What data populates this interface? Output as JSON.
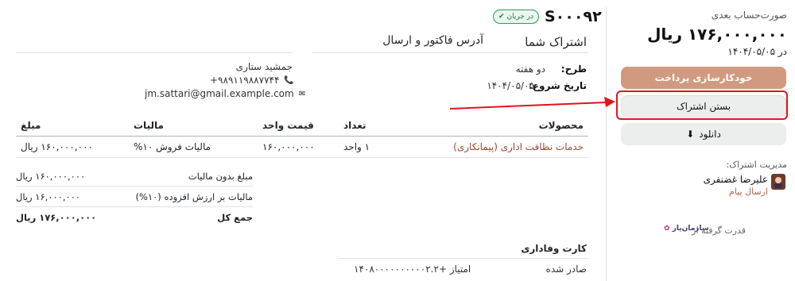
{
  "sidebar": {
    "label": "صورت‌حساب بعدی",
    "amount": "۱۷۶,۰۰۰,۰۰۰ ریال",
    "due": "در ۱۴۰۴/۰۵/۰۵",
    "autopay_button": "خودکارسازی پرداخت",
    "close_button": "بستن اشتراک",
    "download_button": "دانلود",
    "manage_label": "مدیریت اشتراک:",
    "user_name": "علیرضا غضنفری",
    "send_message": "ارسال پیام",
    "powered_by": "قدرت گرفته از",
    "logo_text": "سازمان‌یار"
  },
  "header": {
    "code": "S۰۰۰۹۲",
    "status": "در جریان",
    "subscription_title": "اشتراک شما",
    "address_title": "آدرس فاکتور و ارسال"
  },
  "subscription": {
    "plan_label": "طرح:",
    "plan_value": "دو هفته",
    "start_label": "تاریخ شروع:",
    "start_value": "۱۴۰۴/۰۵/۰۵"
  },
  "customer": {
    "name": "جمشید ستاری",
    "phone": "+۹۸۹۱۱۹۸۸۷۷۴۴",
    "email": "jm.sattari@gmail.example.com"
  },
  "table": {
    "headers": {
      "product": "محصولات",
      "qty": "تعداد",
      "unit_price": "قیمت واحد",
      "tax": "مالیات",
      "amount": "مبلغ"
    },
    "rows": [
      {
        "product": "خدمات نظافت اداری (پیمانکاری)",
        "qty": "۱ واحد",
        "unit_price": "۱۶۰,۰۰۰,۰۰۰",
        "tax": "مالیات فروش ۱۰%",
        "amount": "۱۶۰,۰۰۰,۰۰۰ ریال"
      }
    ]
  },
  "totals": {
    "subtotal_label": "مبلغ بدون مالیات",
    "subtotal_value": "۱۶۰,۰۰۰,۰۰۰ ریال",
    "vat_label": "مالیات بر ارزش افزوده (۱۰%)",
    "vat_value": "۱۶,۰۰۰,۰۰۰ ریال",
    "total_label": "جمع کل",
    "total_value": "۱۷۶,۰۰۰,۰۰۰ ریال"
  },
  "loyalty": {
    "title": "کارت وفاداری",
    "issued_label": "صادر شده",
    "issued_value": "۱۴۰۸۰۰۰۰۰۰۰۰۰۰۲.۲+ امتیاز"
  },
  "colors": {
    "primary": "#d19a80",
    "highlight": "#e3141b",
    "status_green": "#2a9d5f",
    "link_brown": "#9b4a2e"
  }
}
